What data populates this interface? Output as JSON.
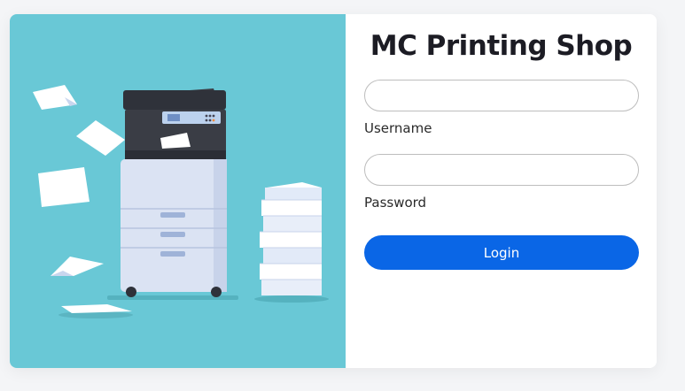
{
  "login": {
    "title": "MC Printing Shop",
    "username": {
      "label": "Username",
      "value": "",
      "placeholder": ""
    },
    "password": {
      "label": "Password",
      "value": "",
      "placeholder": ""
    },
    "login_button": "Login"
  },
  "colors": {
    "illustration_bg": "#69c8d6",
    "button": "#0a66e6",
    "card": "#ffffff",
    "page_bg": "#f4f5f7"
  },
  "icons": {
    "illustration": "printer-with-paper-stacks-illustration"
  }
}
